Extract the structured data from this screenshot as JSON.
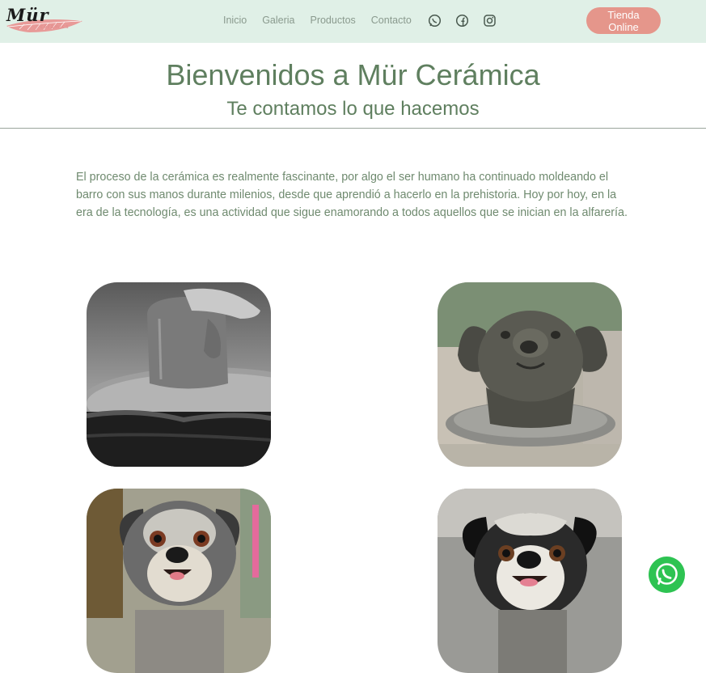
{
  "brand": {
    "logo_text": "Mür",
    "logo_subtext": "cerámica",
    "accent_color": "#e5968b",
    "primary_color": "#5f7f5f",
    "navbar_bg": "#e0f0e7"
  },
  "nav": {
    "links": [
      "Inicio",
      "Galeria",
      "Productos",
      "Contacto"
    ],
    "social_icons": [
      "whatsapp-icon",
      "facebook-icon",
      "instagram-icon"
    ],
    "shop_button": "Tienda Online"
  },
  "hero": {
    "title": "Bienvenidos a Mür Cerámica",
    "subtitle": "Te contamos lo que hacemos"
  },
  "intro": {
    "paragraph": "El proceso de la cerámica es realmente fascinante, por algo el ser humano ha continuado moldeando el barro con sus manos durante milenios, desde que aprendió a hacerlo en la prehistoria. Hoy por hoy, en la era de la tecnología, es una actividad que sigue enamorando a todos aquellos que se inician en la alfarería."
  },
  "gallery": {
    "photos": [
      "pottery-wheel-photo",
      "clay-dog-bust-photo",
      "painted-dog-sculpture-photo",
      "bw-dog-sculpture-photo"
    ]
  },
  "floating": {
    "whatsapp_icon": "whatsapp-icon"
  }
}
